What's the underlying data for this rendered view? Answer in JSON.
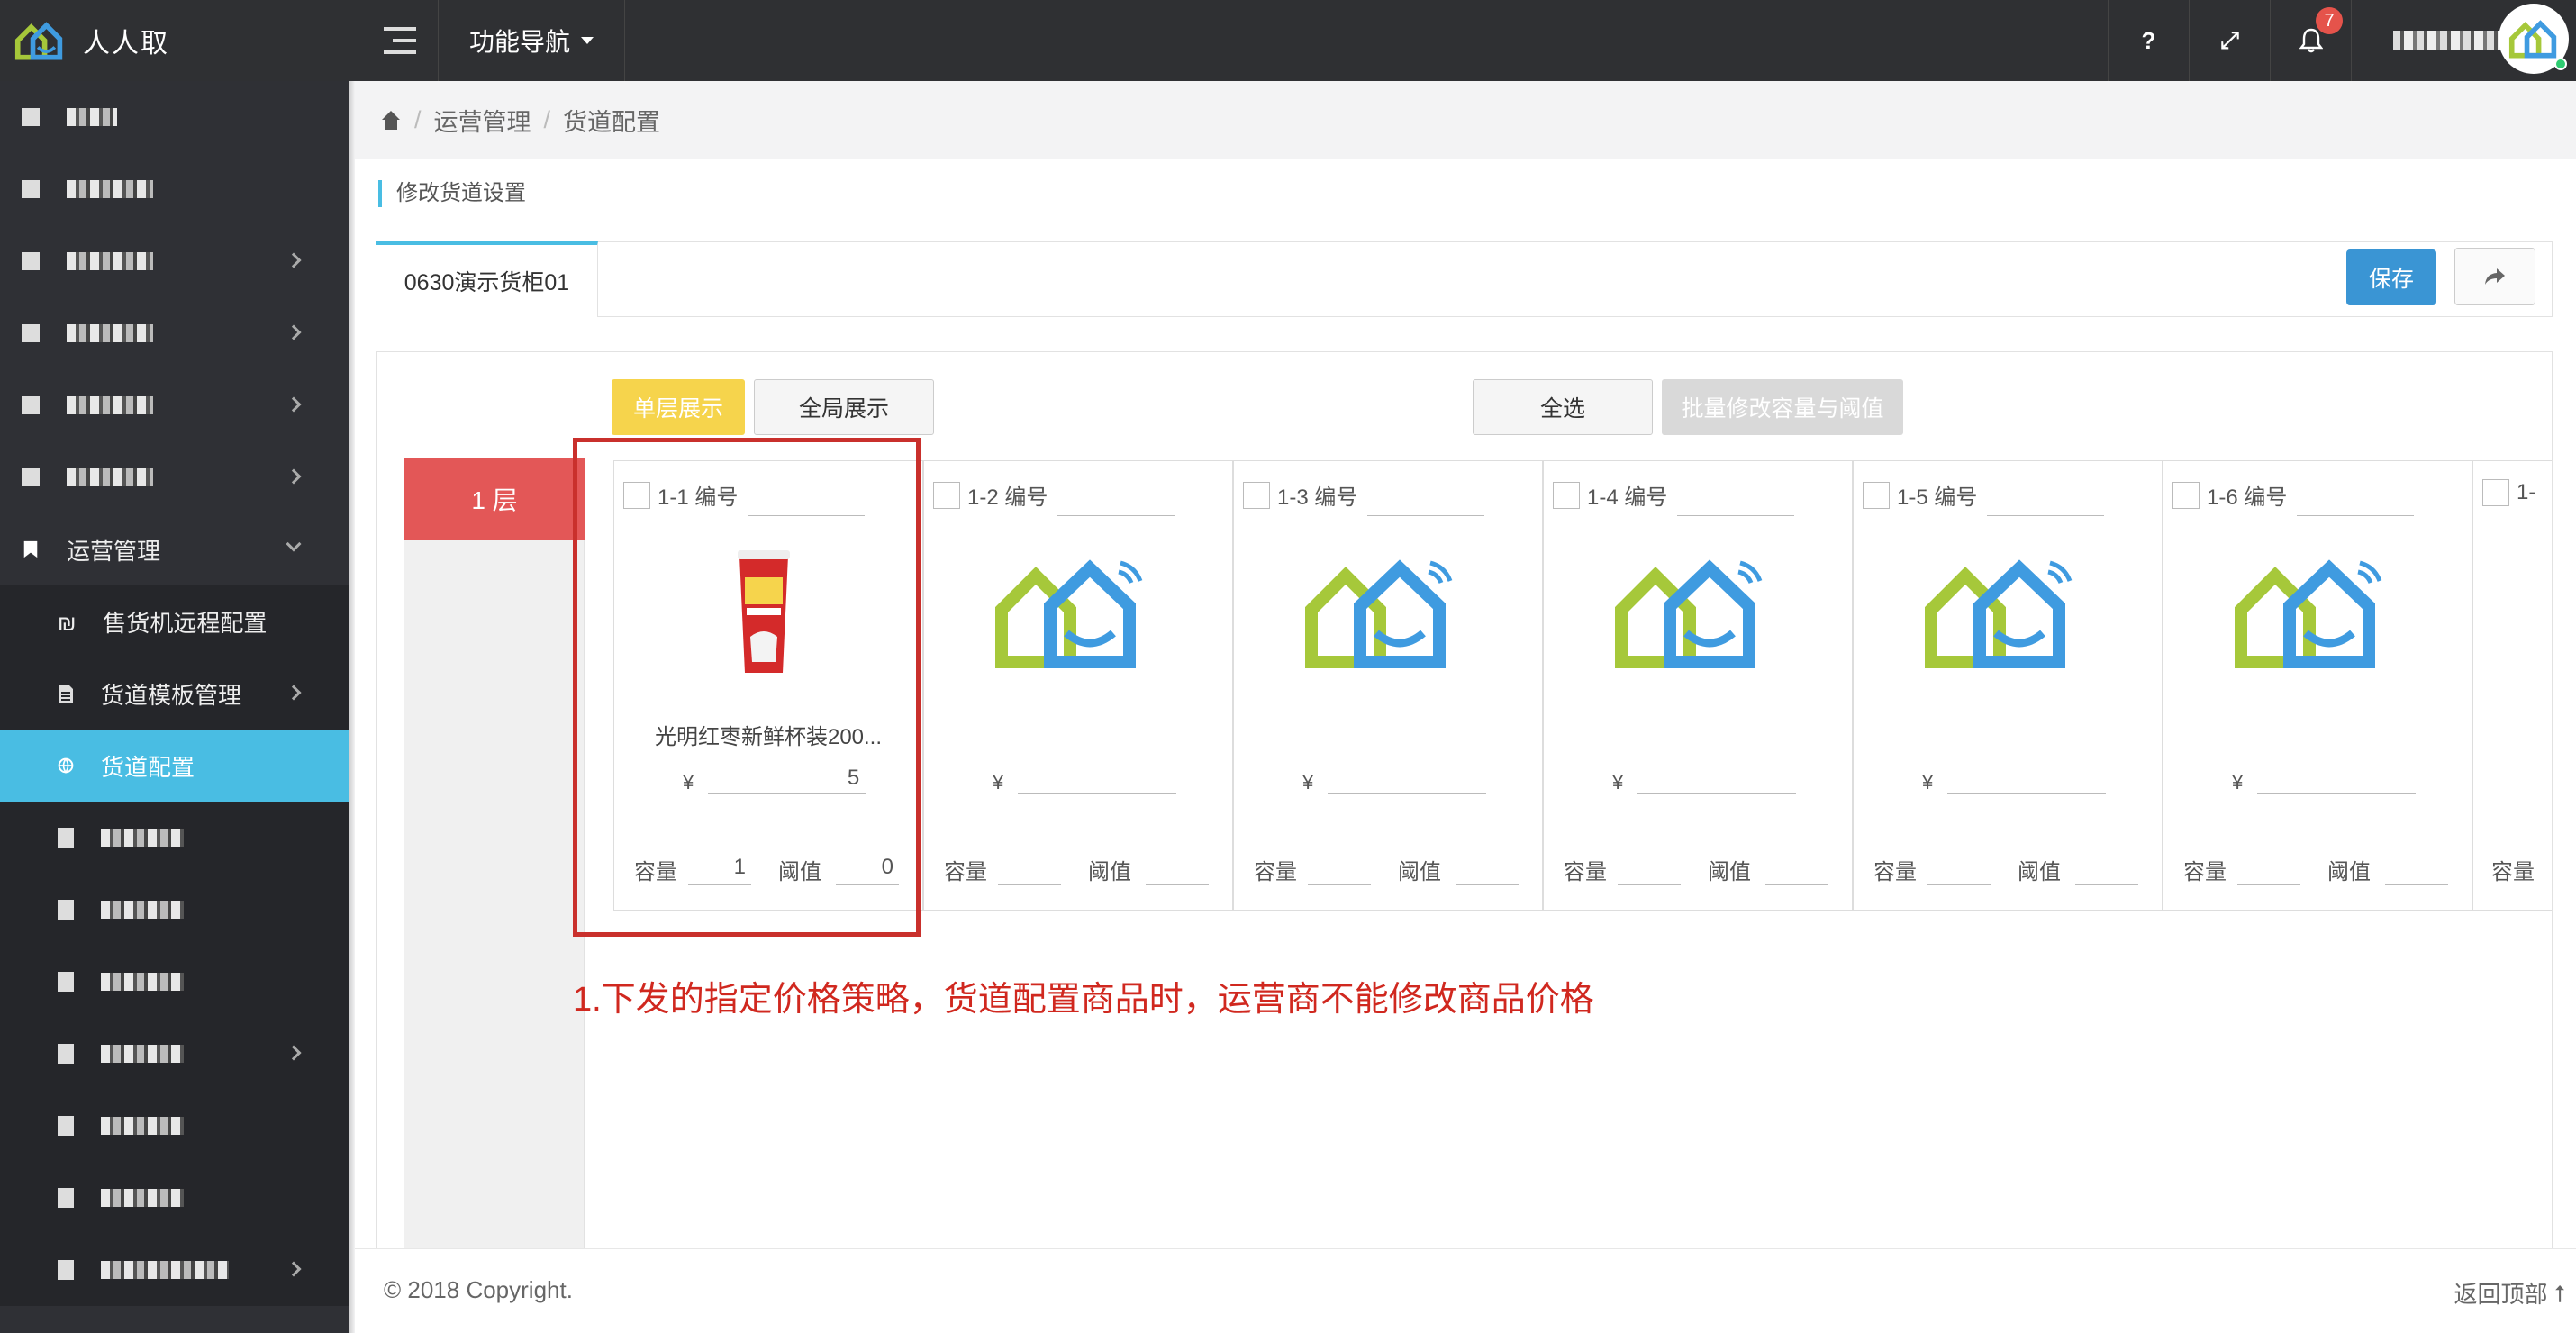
{
  "app": {
    "name": "人人取"
  },
  "topbar": {
    "func_nav_label": "功能导航",
    "help_label": "?",
    "expand_label": "⤢",
    "notification_count": "7"
  },
  "sidebar": {
    "items": [
      {
        "label": "",
        "has_arrow": false
      },
      {
        "label": "",
        "has_arrow": false
      },
      {
        "label": "",
        "has_arrow": true
      },
      {
        "label": "",
        "has_arrow": true
      },
      {
        "label": "",
        "has_arrow": true
      },
      {
        "label": "",
        "has_arrow": true
      }
    ],
    "ops_label": "运营管理",
    "sub_items": [
      {
        "label": "售货机远程配置"
      },
      {
        "label": "货道模板管理"
      },
      {
        "label": "货道配置"
      }
    ]
  },
  "breadcrumb": {
    "level1": "运营管理",
    "level2": "货道配置",
    "sep": "/"
  },
  "page": {
    "title": "修改货道设置",
    "tab_label": "0630演示货柜01",
    "save_label": "保存",
    "share_icon": "share-icon"
  },
  "toolbar": {
    "single_layer": "单层展示",
    "global_view": "全局展示",
    "select_all": "全选",
    "batch_edit": "批量修改容量与阈值"
  },
  "layer": {
    "label": "1 层"
  },
  "slots": [
    {
      "code": "1-1 编号",
      "product": "光明红枣新鲜杯装200...",
      "currency": "¥",
      "price": "5",
      "capacity_label": "容量",
      "capacity": "1",
      "threshold_label": "阈值",
      "threshold": "0"
    },
    {
      "code": "1-2 编号",
      "product": "",
      "currency": "¥",
      "price": "",
      "capacity_label": "容量",
      "capacity": "",
      "threshold_label": "阈值",
      "threshold": ""
    },
    {
      "code": "1-3 编号",
      "product": "",
      "currency": "¥",
      "price": "",
      "capacity_label": "容量",
      "capacity": "",
      "threshold_label": "阈值",
      "threshold": ""
    },
    {
      "code": "1-4 编号",
      "product": "",
      "currency": "¥",
      "price": "",
      "capacity_label": "容量",
      "capacity": "",
      "threshold_label": "阈值",
      "threshold": ""
    },
    {
      "code": "1-5 编号",
      "product": "",
      "currency": "¥",
      "price": "",
      "capacity_label": "容量",
      "capacity": "",
      "threshold_label": "阈值",
      "threshold": ""
    },
    {
      "code": "1-6 编号",
      "product": "",
      "currency": "¥",
      "price": "",
      "capacity_label": "容量",
      "capacity": "",
      "threshold_label": "阈值",
      "threshold": ""
    },
    {
      "code": "1-",
      "product": "",
      "currency": "",
      "price": "",
      "capacity_label": "容量",
      "capacity": "",
      "threshold_label": "",
      "threshold": ""
    }
  ],
  "annotation": "1.下发的指定价格策略，货道配置商品时，运营商不能修改商品价格",
  "footer": {
    "copyright": "© 2018 Copyright.",
    "back_to_top": "返回顶部 ⭡"
  },
  "colors": {
    "accent": "#49bde3",
    "save": "#3a95d4",
    "layer": "#e35757",
    "single_btn": "#f6d44c",
    "annotation": "#d0281f"
  }
}
